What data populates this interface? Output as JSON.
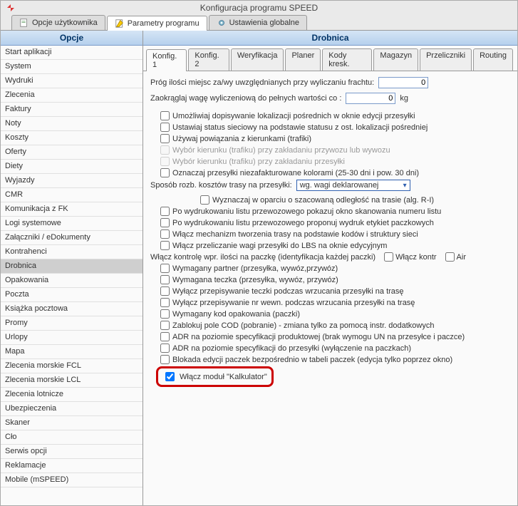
{
  "window": {
    "title": "Konfiguracja programu SPEED"
  },
  "mainTabs": [
    {
      "label": "Opcje użytkownika",
      "active": false
    },
    {
      "label": "Parametry programu",
      "active": true
    },
    {
      "label": "Ustawienia globalne",
      "active": false
    }
  ],
  "sidebar": {
    "header": "Opcje",
    "items": [
      "Start aplikacji",
      "System",
      "Wydruki",
      "Zlecenia",
      "Faktury",
      "Noty",
      "Koszty",
      "Oferty",
      "Diety",
      "Wyjazdy",
      "CMR",
      "Komunikacja z FK",
      "Logi systemowe",
      "Załączniki / eDokumenty",
      "Kontrahenci",
      "Drobnica",
      "Opakowania",
      "Poczta",
      "Książka pocztowa",
      "Promy",
      "Urlopy",
      "Mapa",
      "Zlecenia morskie FCL",
      "Zlecenia morskie LCL",
      "Zlecenia lotnicze",
      "Ubezpieczenia",
      "Skaner",
      "Cło",
      "Serwis opcji",
      "Reklamacje",
      "Mobile (mSPEED)"
    ],
    "selected": "Drobnica"
  },
  "main": {
    "header": "Drobnica",
    "subTabs": [
      "Konfig. 1",
      "Konfig. 2",
      "Weryfikacja",
      "Planer",
      "Kody kresk.",
      "Magazyn",
      "Przeliczniki",
      "Routing"
    ],
    "activeSubTab": "Konfig. 1",
    "row1": {
      "label": "Próg ilości miejsc za/wy uwzględnianych przy wyliczaniu frachtu:",
      "value": "0"
    },
    "row2": {
      "label": "Zaokrąglaj wagę wyliczeniową do pełnych wartości co :",
      "value": "0",
      "unit": "kg"
    },
    "checks": {
      "c1": "Umożliwiaj dopisywanie lokalizacji pośrednich w oknie edycji przesyłki",
      "c2": "Ustawiaj status sieciowy na podstawie statusu z ost. lokalizacji pośredniej",
      "c3": "Używaj powiązania z kierunkami (trafiki)",
      "c4": "Wybór kierunku (trafiku) przy zakładaniu przywozu lub wywozu",
      "c5": "Wybór kierunku (trafiku) przy zakładaniu przesyłki",
      "c6": "Oznaczaj przesyłki niezafakturowane kolorami (25-30 dni i pow. 30 dni)",
      "splitLabel": "Sposób rozb. kosztów trasy na przesyłki:",
      "splitValue": "wg. wagi deklarowanej",
      "c7": "Wyznaczaj w oparciu o szacowaną odległość na trasie (alg. R-I)",
      "c8": "Po wydrukowaniu listu przewozowego pokazuj okno skanowania numeru listu",
      "c9": "Po wydrukowaniu listu przewozowego proponuj wydruk etykiet paczkowych",
      "c10": "Włącz mechanizm tworzenia trasy na podstawie kodów i struktury sieci",
      "c11": "Włącz przeliczanie wagi przesyłki do LBS na oknie edycyjnym",
      "ctrlLabel": "Włącz kontrolę wpr. ilości na paczkę (identyfikacja każdej paczki)",
      "ctrlOpt1": "Włącz kontr",
      "ctrlOpt2": "Air",
      "c12": "Wymagany partner (przesyłka, wywóz,przywóz)",
      "c13": "Wymagana teczka (przesyłka, wywóz, przywóz)",
      "c14": "Wyłącz przepisywanie teczki podczas wrzucania przesyłki na trasę",
      "c15": "Wyłącz przepisywanie nr wewn. podczas wrzucania przesyłki na trasę",
      "c16": "Wymagany kod opakowania (paczki)",
      "c17": "Zablokuj pole COD (pobranie) - zmiana tylko za pomocą instr. dodatkowych",
      "c18": "ADR na poziomie specyfikacji produktowej (brak wymogu UN na przesyłce i paczce)",
      "c19": "ADR na poziomie specyfikacji do przesyłki (wyłączenie na paczkach)",
      "c20": "Blokada edycji paczek bezpośrednio w tabeli paczek (edycja tylko poprzez okno)",
      "c21": "Włącz moduł \"Kalkulator\""
    }
  }
}
